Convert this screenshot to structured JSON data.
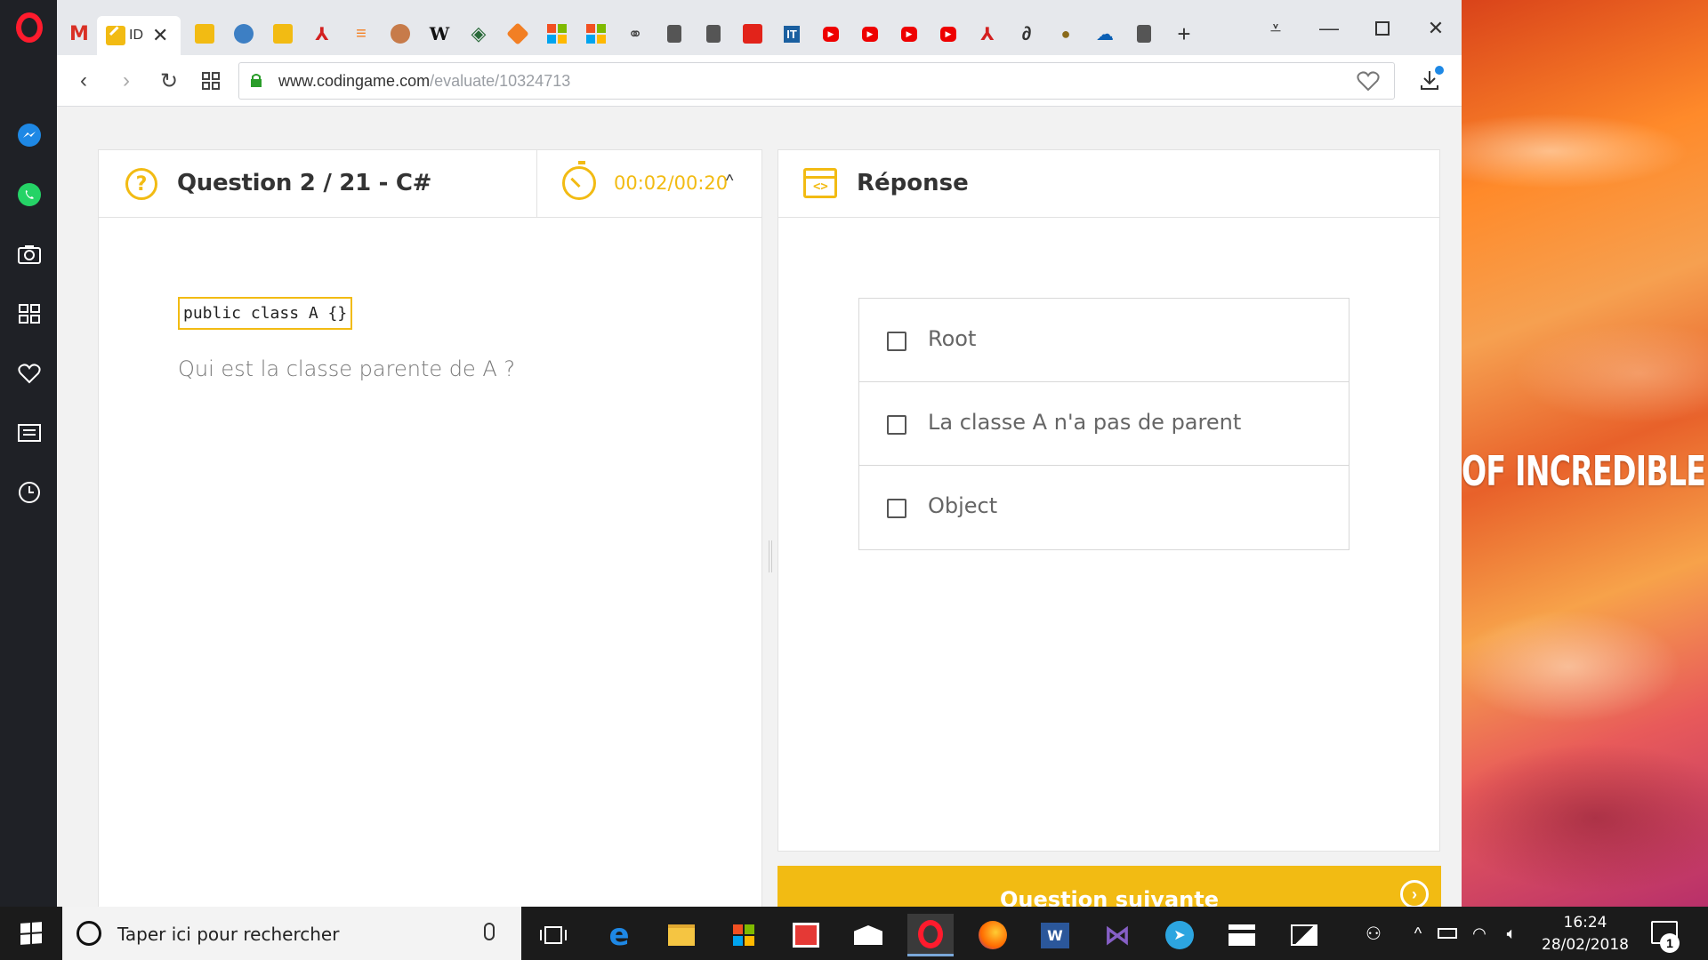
{
  "wallpaper": {
    "text": "OF INCREDIBLE"
  },
  "browser": {
    "tabs": [
      {
        "icon": "gmail-icon"
      },
      {
        "icon": "codingame-icon",
        "title": "ID",
        "active": true
      },
      {
        "icon": "codingame-icon"
      },
      {
        "icon": "globe-icon"
      },
      {
        "icon": "codingame-icon"
      },
      {
        "icon": "acrobat-icon"
      },
      {
        "icon": "stackoverflow-icon"
      },
      {
        "icon": "cookie-icon"
      },
      {
        "icon": "wikipedia-icon",
        "glyph": "W"
      },
      {
        "icon": "diamond-icon"
      },
      {
        "icon": "puzzle-icon"
      },
      {
        "icon": "microsoft-icon"
      },
      {
        "icon": "microsoft-icon"
      },
      {
        "icon": "bike-icon"
      },
      {
        "icon": "document-icon"
      },
      {
        "icon": "document-icon"
      },
      {
        "icon": "news-icon"
      },
      {
        "icon": "it-icon",
        "glyph": "IT"
      },
      {
        "icon": "youtube-icon"
      },
      {
        "icon": "youtube-icon"
      },
      {
        "icon": "youtube-icon"
      },
      {
        "icon": "youtube-icon"
      },
      {
        "icon": "acrobat-icon"
      },
      {
        "icon": "scribble-icon"
      },
      {
        "icon": "bee-icon"
      },
      {
        "icon": "onedrive-icon"
      },
      {
        "icon": "document-icon"
      }
    ],
    "url_host": "www.codingame.com",
    "url_path": "/evaluate/10324713"
  },
  "question": {
    "title": "Question 2 / 21 - C#",
    "timer": "00:02/00:20",
    "code": "public class A {}",
    "text": "Qui est la classe parente de A ?"
  },
  "response": {
    "title": "Réponse",
    "options": [
      "Root",
      "La classe A n'a pas de parent",
      "Object"
    ]
  },
  "next_button": {
    "label": "Question suivante"
  },
  "taskbar": {
    "search_placeholder": "Taper ici pour rechercher",
    "time": "16:24",
    "date": "28/02/2018",
    "notification_count": "1"
  },
  "colors": {
    "accent": "#f2bb13",
    "opera": "#ff1b2d",
    "taskbar": "#1b1b1b"
  }
}
